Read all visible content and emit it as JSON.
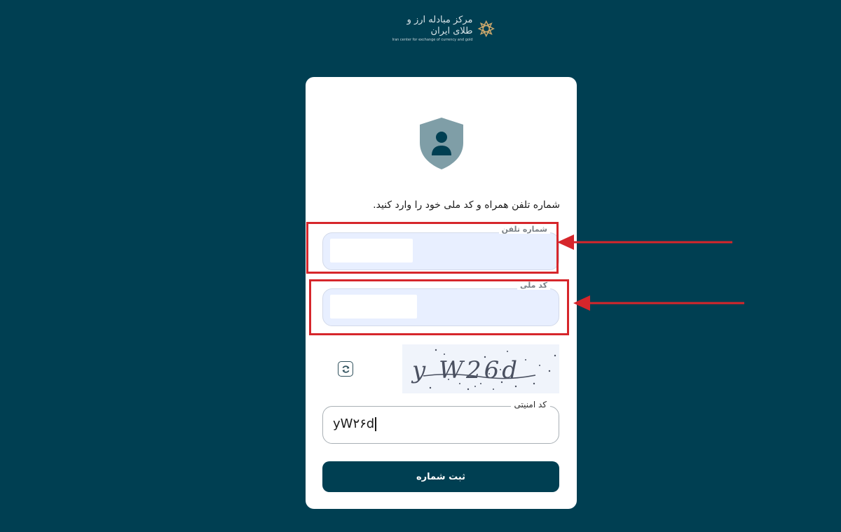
{
  "logo": {
    "title": "مرکز مبادله ارز و طلای ایران",
    "subtitle": "Iran center for exchange of currency and gold"
  },
  "form": {
    "instruction": "شماره تلفن همراه و کد ملی خود را وارد کنید.",
    "phone": {
      "label": "شماره تلفن",
      "value": ""
    },
    "national_code": {
      "label": "کد ملی",
      "value": ""
    },
    "captcha": {
      "image_text": "y W26d"
    },
    "security_code": {
      "label": "کد امنیتی",
      "value": "yW۲۶d"
    },
    "submit_label": "ثبت شماره"
  },
  "colors": {
    "background": "#003f52",
    "card": "#ffffff",
    "input_fill": "#e8efff",
    "shield": "#7f9ea7",
    "shield_icon": "#003f52",
    "annotation": "#d6262b",
    "button": "#003f52"
  },
  "icons": {
    "logo": "logo-mark-icon",
    "shield": "user-shield-icon",
    "refresh": "refresh-icon",
    "arrow": "arrow-left-icon"
  }
}
